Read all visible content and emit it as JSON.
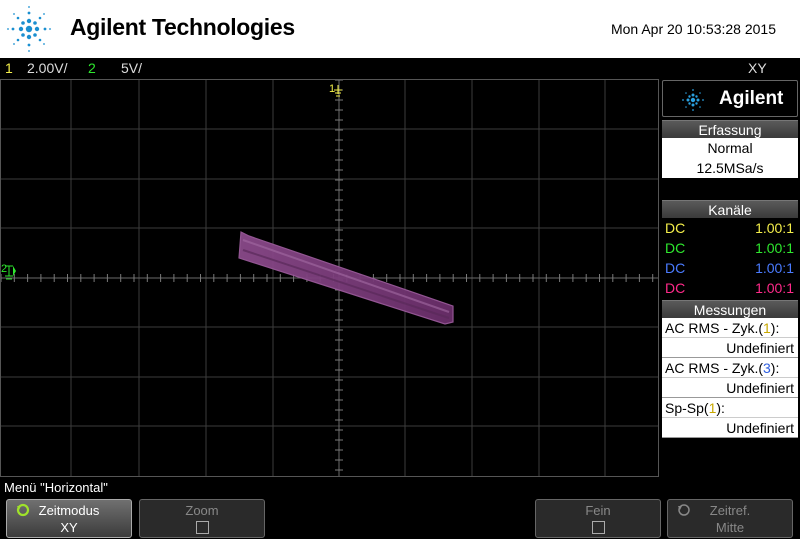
{
  "header": {
    "brand": "Agilent Technologies",
    "datetime": "Mon Apr 20 10:53:28 2015"
  },
  "statusbar": {
    "ch1_num": "1",
    "ch1_scale": "2.00V/",
    "ch2_num": "2",
    "ch2_scale": "5V/",
    "mode": "XY"
  },
  "screen": {
    "marker_ch1": "1",
    "marker_ch2": "2",
    "trace_color": "#7a3a7a"
  },
  "panel": {
    "brand": "Agilent",
    "acquisition": {
      "title": "Erfassung",
      "mode": "Normal",
      "rate": "12.5MSa/s"
    },
    "channels": {
      "title": "Kanäle",
      "rows": [
        {
          "coupling": "DC",
          "probe": "1.00:1",
          "color": "#f5f04a"
        },
        {
          "coupling": "DC",
          "probe": "1.00:1",
          "color": "#2ee82e"
        },
        {
          "coupling": "DC",
          "probe": "1.00:1",
          "color": "#4a7bff"
        },
        {
          "coupling": "DC",
          "probe": "1.00:1",
          "color": "#ff2a8a"
        }
      ]
    },
    "measurements": {
      "title": "Messungen",
      "items": [
        {
          "label_pre": "AC RMS - Zyk.(",
          "channel": "1",
          "label_post": "):",
          "value": "Undefiniert",
          "ch_color": "#c8a800"
        },
        {
          "label_pre": "AC RMS - Zyk.(",
          "channel": "3",
          "label_post": "):",
          "value": "Undefiniert",
          "ch_color": "#2f5fe0"
        },
        {
          "label_pre": "Sp-Sp(",
          "channel": "1",
          "label_post": "):",
          "value": "Undefiniert",
          "ch_color": "#c8a800"
        }
      ]
    }
  },
  "menu": {
    "title": "Menü \"Horizontal\"",
    "keys": {
      "zeitmodus_label": "Zeitmodus",
      "zeitmodus_value": "XY",
      "zoom_label": "Zoom",
      "fein_label": "Fein",
      "zeitref_label": "Zeitref.",
      "zeitref_value": "Mitte"
    }
  }
}
